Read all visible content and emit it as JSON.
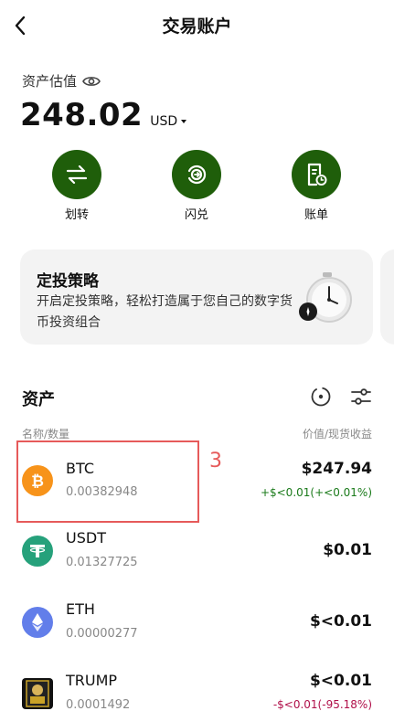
{
  "header": {
    "title": "交易账户"
  },
  "portfolio": {
    "label": "资产估值",
    "balance": "248.02",
    "currency": "USD"
  },
  "actions": [
    {
      "label": "划转",
      "icon": "transfer-icon"
    },
    {
      "label": "闪兑",
      "icon": "swap-icon"
    },
    {
      "label": "账单",
      "icon": "bill-icon"
    }
  ],
  "dca": {
    "title": "定投策略",
    "desc": "开启定投策略，轻松打造属于您自己的数字货币投资组合"
  },
  "assets": {
    "title": "资产",
    "col_left": "名称/数量",
    "col_right": "价值/现货收益",
    "items": [
      {
        "symbol": "BTC",
        "amount": "0.00382948",
        "value": "$247.94",
        "pnl": "+$<0.01(+<0.01%)",
        "color": "#f7931a"
      },
      {
        "symbol": "USDT",
        "amount": "0.01327725",
        "value": "$0.01",
        "pnl": "",
        "color": "#26a17b"
      },
      {
        "symbol": "ETH",
        "amount": "0.00000277",
        "value": "$<0.01",
        "pnl": "",
        "color": "#627eea"
      },
      {
        "symbol": "TRUMP",
        "amount": "0.0001492",
        "value": "$<0.01",
        "pnl": "-$<0.01(-95.18%)",
        "color": "#111111"
      }
    ]
  },
  "annotation": {
    "marker": "3"
  }
}
